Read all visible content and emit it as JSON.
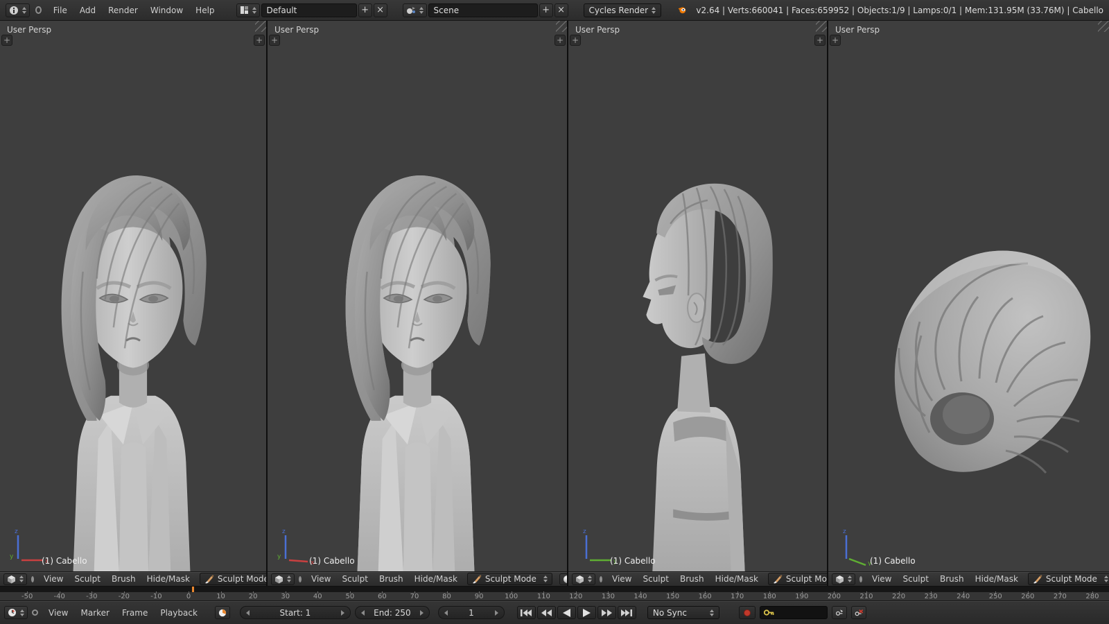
{
  "topbar": {
    "menus": [
      "File",
      "Add",
      "Render",
      "Window",
      "Help"
    ],
    "layout": {
      "value": "Default",
      "add_label": "+",
      "close_label": "×"
    },
    "scene": {
      "value": "Scene",
      "add_label": "+",
      "close_label": "×"
    },
    "engine": "Cycles Render",
    "stats": "v2.64 | Verts:660041 | Faces:659952 | Objects:1/9 | Lamps:0/1 | Mem:131.95M (33.76M) | Cabello"
  },
  "viewport": {
    "label": "User Persp",
    "object": "(1) Cabello",
    "menus": [
      "View",
      "Sculpt",
      "Brush",
      "Hide/Mask"
    ],
    "mode": "Sculpt Mode",
    "add_region_label": "+"
  },
  "timeline": {
    "menus": [
      "View",
      "Marker",
      "Frame",
      "Playback"
    ],
    "start_field": "Start: 1",
    "end_field": "End: 250",
    "current_frame": "1",
    "sync_mode": "No Sync",
    "ruler_ticks": [
      -50,
      -40,
      -30,
      -20,
      -10,
      0,
      10,
      20,
      30,
      40,
      50,
      60,
      70,
      80,
      90,
      100,
      110,
      120,
      130,
      140,
      150,
      160,
      170,
      180,
      190,
      200,
      210,
      220,
      230,
      240,
      250,
      260,
      270,
      280
    ],
    "current_frame_value": 1
  },
  "colors": {
    "accent_orange": "#e8862e",
    "record_red": "#c0392b",
    "axis_x_red": "#c94040",
    "axis_y_green": "#5fae33",
    "axis_z_blue": "#4a6fd4",
    "key_yellow": "#d9c24a",
    "viewport_bg": "#3e3e3e"
  }
}
